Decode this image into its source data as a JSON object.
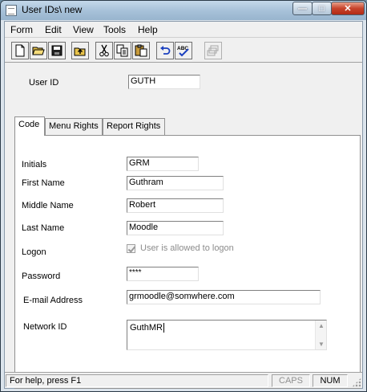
{
  "window": {
    "title": "User IDs\\ new",
    "minimize_glyph": "—",
    "maximize_glyph": "□",
    "close_glyph": "✕"
  },
  "menu": {
    "items": [
      "Form",
      "Edit",
      "View",
      "Tools",
      "Help"
    ]
  },
  "toolbar": {
    "buttons": [
      {
        "name": "new-icon"
      },
      {
        "name": "open-folder-icon"
      },
      {
        "name": "save-icon"
      },
      {
        "name": "up-folder-icon"
      },
      {
        "name": "cut-icon"
      },
      {
        "name": "copy-icon"
      },
      {
        "name": "paste-icon"
      },
      {
        "name": "undo-icon"
      },
      {
        "name": "spellcheck-icon"
      },
      {
        "name": "stack-disabled-icon"
      }
    ],
    "spellcheck_text": "ABC"
  },
  "form": {
    "user_id_label": "User ID",
    "user_id_value": "GUTH",
    "tabs": [
      "Code",
      "Menu Rights",
      "Report Rights"
    ],
    "active_tab": "Code",
    "fields": {
      "initials_label": "Initials",
      "initials_value": "GRM",
      "first_name_label": "First Name",
      "first_name_value": "Guthram",
      "middle_name_label": "Middle Name",
      "middle_name_value": "Robert",
      "last_name_label": "Last Name",
      "last_name_value": "Moodle",
      "logon_label": "Logon",
      "logon_checkbox_label": "User is allowed to logon",
      "logon_checked": true,
      "password_label": "Password",
      "password_value": "****",
      "email_label": "E-mail Address",
      "email_value": "grmoodle@somwhere.com",
      "network_id_label": "Network ID",
      "network_id_value": "GuthMR"
    }
  },
  "status": {
    "help_text": "For help, press F1",
    "caps": "CAPS",
    "num": "NUM"
  }
}
